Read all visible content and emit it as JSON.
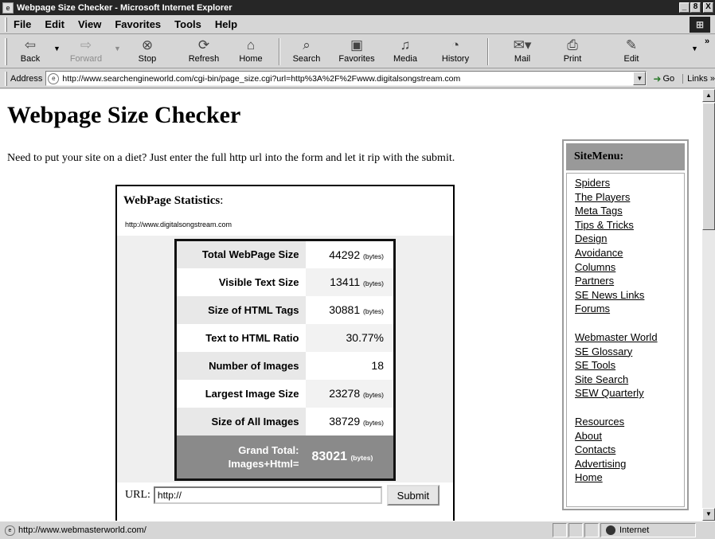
{
  "window": {
    "title": "Webpage Size Checker - Microsoft Internet Explorer",
    "minimize": "_",
    "maximize": "8",
    "close": "X"
  },
  "menu": {
    "file": "File",
    "edit": "Edit",
    "view": "View",
    "favorites": "Favorites",
    "tools": "Tools",
    "help": "Help"
  },
  "toolbar": {
    "back": "Back",
    "forward": "Forward",
    "stop": "Stop",
    "refresh": "Refresh",
    "home": "Home",
    "search": "Search",
    "favorites": "Favorites",
    "media": "Media",
    "history": "History",
    "mail": "Mail",
    "print": "Print",
    "edit": "Edit",
    "more": "»"
  },
  "address": {
    "label": "Address",
    "url": "http://www.searchengineworld.com/cgi-bin/page_size.cgi?url=http%3A%2F%2Fwww.digitalsongstream.com",
    "go": "Go",
    "links": "Links »"
  },
  "page": {
    "title": "Webpage Size Checker",
    "intro": "Need to put your site on a diet? Just enter the full http url into the form and let it rip with the submit."
  },
  "stats": {
    "title_bold": "WebPage Statistics",
    "title_rest": ":",
    "url": "http://www.digitalsongstream.com",
    "rows": [
      {
        "label": "Total WebPage Size",
        "value": "44292",
        "unit": "(bytes)"
      },
      {
        "label": "Visible Text Size",
        "value": "13411",
        "unit": "(bytes)"
      },
      {
        "label": "Size of HTML Tags",
        "value": "30881",
        "unit": "(bytes)"
      },
      {
        "label": "Text to HTML Ratio",
        "value": "30.77%",
        "unit": ""
      },
      {
        "label": "Number of Images",
        "value": "18",
        "unit": ""
      },
      {
        "label": "Largest Image Size",
        "value": "23278",
        "unit": "(bytes)"
      },
      {
        "label": "Size of All Images",
        "value": "38729",
        "unit": "(bytes)"
      }
    ],
    "total_label_1": "Grand Total:",
    "total_label_2": "Images+Html=",
    "total_value": "83021",
    "total_unit": "(bytes)"
  },
  "form": {
    "url_label": "URL:",
    "url_value": "http://",
    "submit": "Submit"
  },
  "sitemenu": {
    "header": "SiteMenu:",
    "group1": [
      "Spiders",
      "The Players",
      "Meta Tags",
      "Tips & Tricks",
      "Design",
      "Avoidance",
      "Columns",
      "Partners",
      "SE News Links",
      "Forums"
    ],
    "group2": [
      "Webmaster World",
      "SE Glossary",
      "SE Tools",
      "Site Search",
      "SEW Quarterly"
    ],
    "group3": [
      "Resources",
      "About",
      "Contacts",
      "Advertising",
      "Home"
    ]
  },
  "status": {
    "text": "http://www.webmasterworld.com/",
    "zone": "Internet"
  }
}
